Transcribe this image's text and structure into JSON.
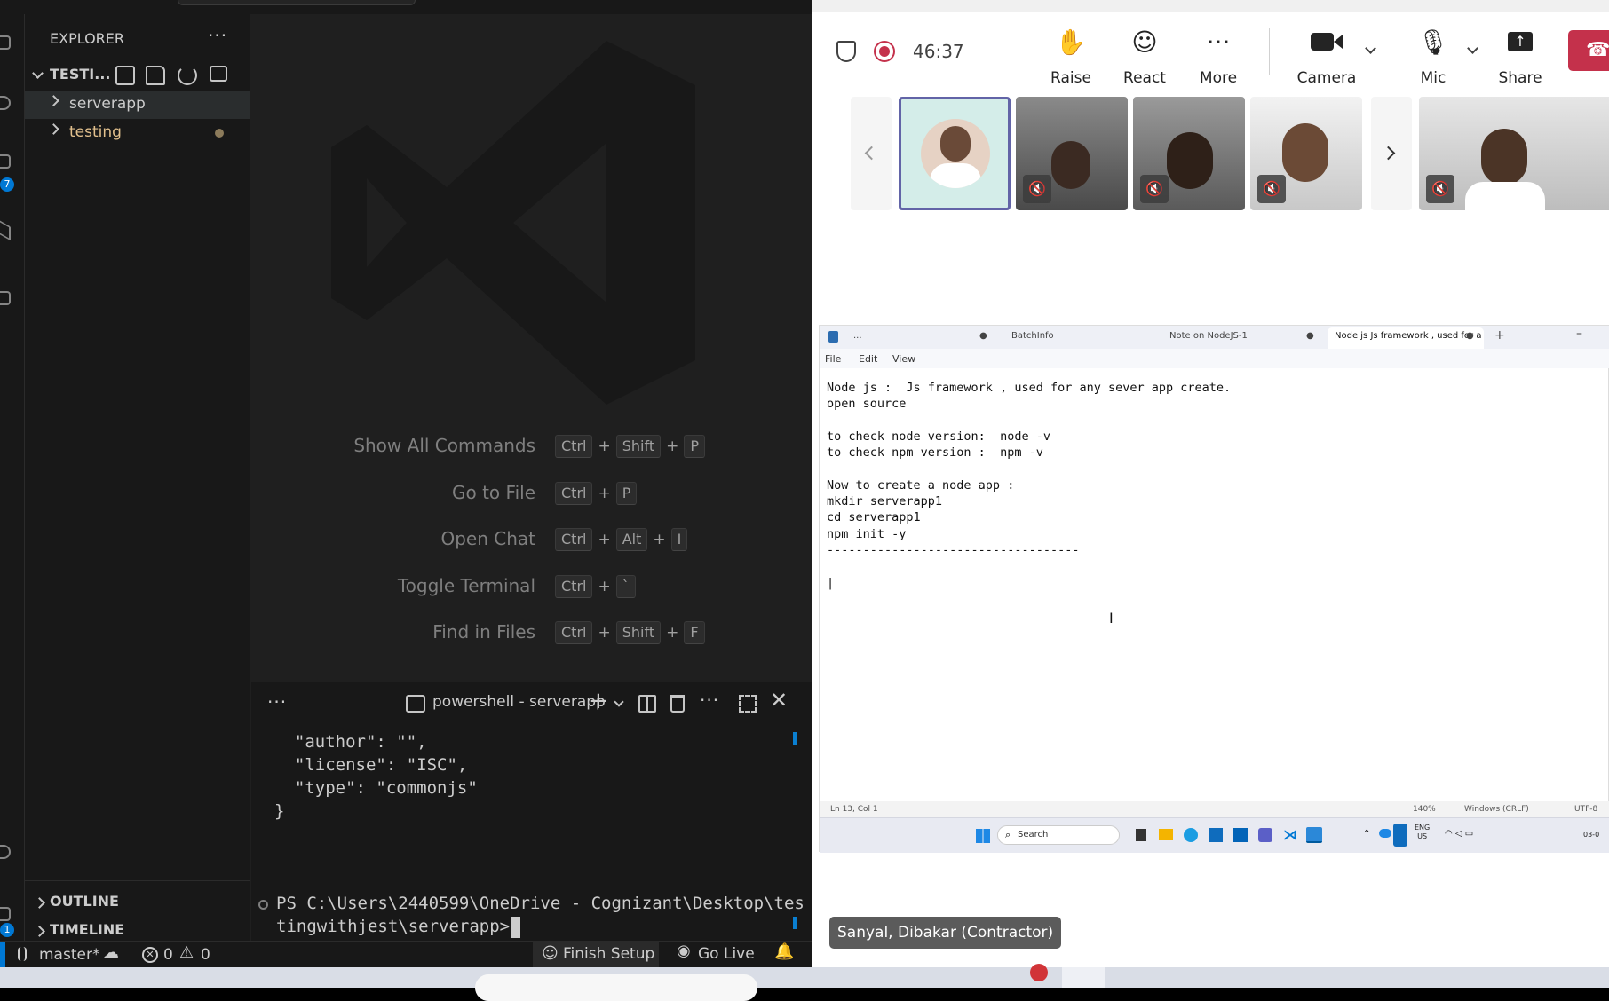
{
  "vscode": {
    "sidebar": {
      "title": "EXPLORER",
      "more": "···",
      "workspace": "TESTI...",
      "items": [
        {
          "label": "serverapp",
          "color": "#cccccc"
        },
        {
          "label": "testing",
          "color": "#e2c08d"
        }
      ],
      "outline": "OUTLINE",
      "timeline": "TIMELINE"
    },
    "activity_badges": [
      "7",
      "1"
    ],
    "welcome_shortcuts": [
      {
        "label": "Show All Commands",
        "keys": [
          "Ctrl",
          "Shift",
          "P"
        ]
      },
      {
        "label": "Go to File",
        "keys": [
          "Ctrl",
          "P"
        ]
      },
      {
        "label": "Open Chat",
        "keys": [
          "Ctrl",
          "Alt",
          "I"
        ]
      },
      {
        "label": "Toggle Terminal",
        "keys": [
          "Ctrl",
          "`"
        ]
      },
      {
        "label": "Find in Files",
        "keys": [
          "Ctrl",
          "Shift",
          "F"
        ]
      }
    ],
    "panel": {
      "more": "···",
      "terminal_name": "powershell - serverapp",
      "lines": [
        "  \"author\": \"\",",
        "  \"license\": \"ISC\",",
        "  \"type\": \"commonjs\"",
        "}"
      ],
      "prompt_line1": "PS C:\\Users\\2440599\\OneDrive - Cognizant\\Desktop\\tes",
      "prompt_line2": "tingwithjest\\serverapp>"
    },
    "statusbar": {
      "branch": "master*",
      "errors": "0",
      "warnings": "0",
      "finish_setup": "Finish Setup",
      "go_live": "Go Live"
    }
  },
  "teams": {
    "timer": "46:37",
    "toolbar": [
      {
        "label": "Raise",
        "icon": "hand-icon"
      },
      {
        "label": "React",
        "icon": "smile-icon"
      },
      {
        "label": "More",
        "icon": "more-icon"
      },
      {
        "label": "Camera",
        "icon": "camera-icon"
      },
      {
        "label": "Mic",
        "icon": "mic-off-icon"
      },
      {
        "label": "Share",
        "icon": "share-icon"
      }
    ],
    "presenter_name": "Sanyal, Dibakar (Contractor)",
    "notepad": {
      "tabs": [
        {
          "label": "..."
        },
        {
          "label": "BatchInfo"
        },
        {
          "label": "Note on NodeJS-1"
        },
        {
          "label": "Node js   Js framework , used for a"
        }
      ],
      "menu": [
        "File",
        "Edit",
        "View"
      ],
      "text": "Node js :  Js framework , used for any sever app create.\nopen source\n\nto check node version:  node -v\nto check npm version :  npm -v\n\nNow to create a node app :\nmkdir serverapp1\ncd serverapp1\nnpm init -y\n-----------------------------------\n\n|",
      "status": {
        "position": "Ln 13, Col 1",
        "zoom": "140%",
        "line_ending": "Windows (CRLF)",
        "encoding": "UTF-8"
      },
      "taskbar_search": "Search",
      "tray_lang": "ENG",
      "tray_region": "US",
      "tray_date": "03-0"
    }
  }
}
